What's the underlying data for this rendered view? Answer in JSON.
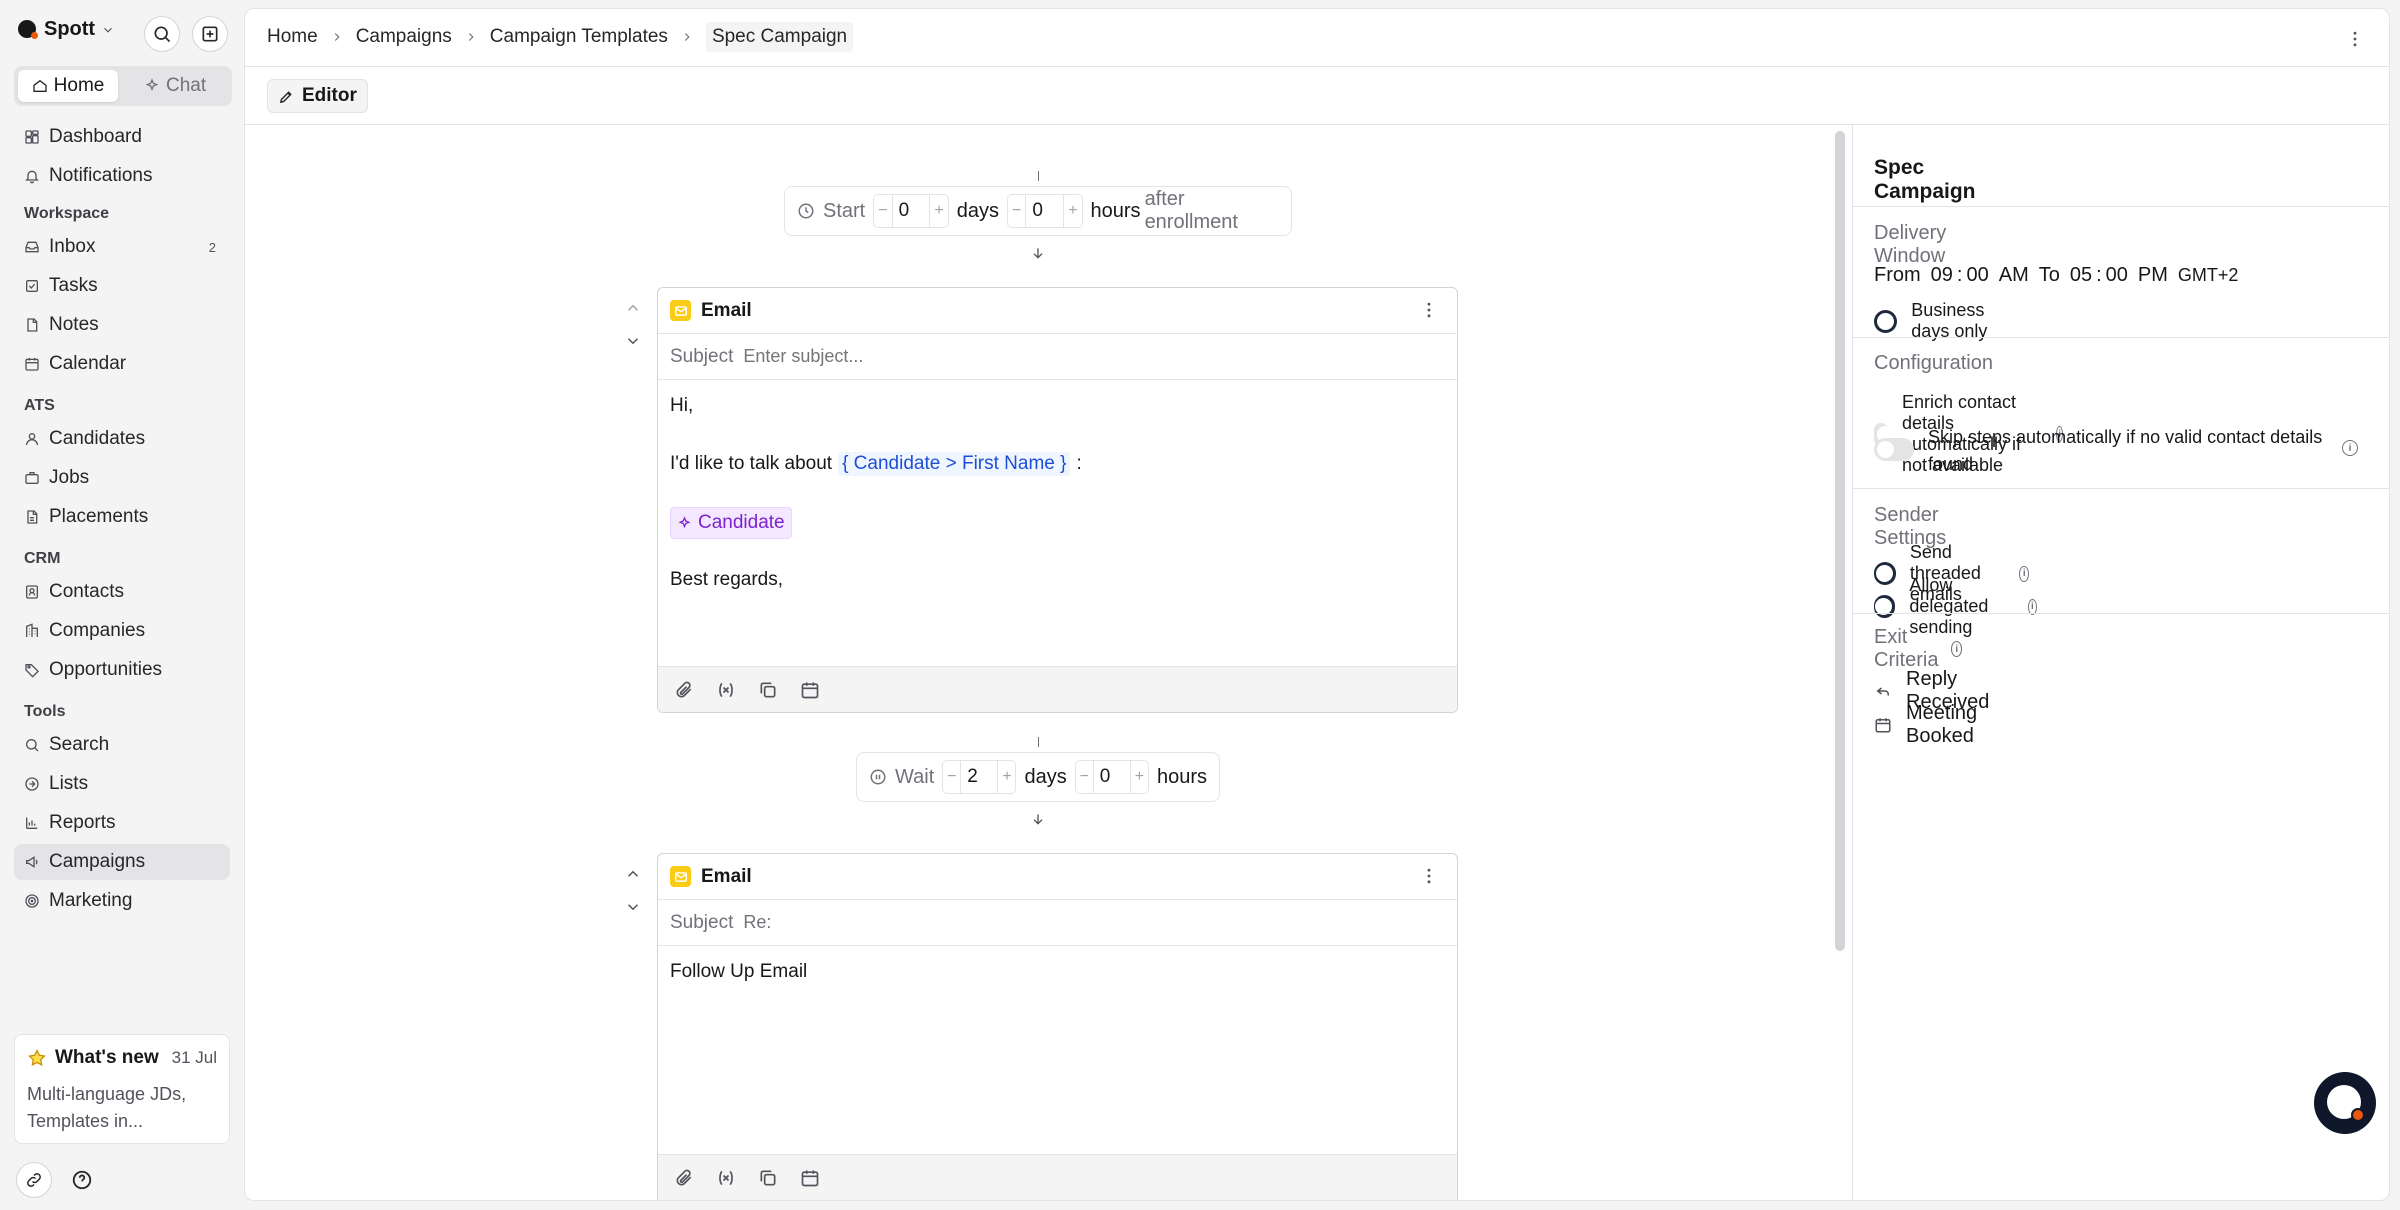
{
  "app": {
    "name": "Spott"
  },
  "sidebar": {
    "home_tab": "Home",
    "chat_tab": "Chat",
    "items_top": [
      {
        "label": "Dashboard",
        "icon": "dashboard-icon"
      },
      {
        "label": "Notifications",
        "icon": "bell-icon"
      }
    ],
    "sections": [
      {
        "label": "Workspace",
        "items": [
          {
            "label": "Inbox",
            "icon": "inbox-icon",
            "badge": "2"
          },
          {
            "label": "Tasks",
            "icon": "tasks-icon"
          },
          {
            "label": "Notes",
            "icon": "notes-icon"
          },
          {
            "label": "Calendar",
            "icon": "calendar-icon"
          }
        ]
      },
      {
        "label": "ATS",
        "items": [
          {
            "label": "Candidates",
            "icon": "user-icon"
          },
          {
            "label": "Jobs",
            "icon": "briefcase-icon"
          },
          {
            "label": "Placements",
            "icon": "document-icon"
          }
        ]
      },
      {
        "label": "CRM",
        "items": [
          {
            "label": "Contacts",
            "icon": "contacts-icon"
          },
          {
            "label": "Companies",
            "icon": "building-icon"
          },
          {
            "label": "Opportunities",
            "icon": "tag-icon"
          }
        ]
      },
      {
        "label": "Tools",
        "items": [
          {
            "label": "Search",
            "icon": "search-icon"
          },
          {
            "label": "Lists",
            "icon": "list-icon"
          },
          {
            "label": "Reports",
            "icon": "chart-icon"
          },
          {
            "label": "Campaigns",
            "icon": "megaphone-icon",
            "active": true
          },
          {
            "label": "Marketing",
            "icon": "target-icon"
          }
        ]
      }
    ],
    "whats_new": {
      "title": "What's new",
      "date": "31 Jul",
      "text": "Multi-language JDs, Templates in..."
    }
  },
  "breadcrumb": [
    "Home",
    "Campaigns",
    "Campaign Templates",
    "Spec Campaign"
  ],
  "toolbar": {
    "editor_label": "Editor"
  },
  "flow": {
    "start": {
      "label": "Start",
      "days": "0",
      "days_label": "days",
      "hours": "0",
      "hours_label": "hours",
      "suffix": "after enrollment"
    },
    "email1": {
      "title": "Email",
      "subject_label": "Subject",
      "subject_placeholder": "Enter subject...",
      "greeting": "Hi,",
      "line_prefix": "I'd like to talk about",
      "variable": "{ Candidate > First Name }",
      "line_suffix": ":",
      "tag": "Candidate",
      "closing": "Best regards,"
    },
    "wait": {
      "label": "Wait",
      "days": "2",
      "days_label": "days",
      "hours": "0",
      "hours_label": "hours"
    },
    "email2": {
      "title": "Email",
      "subject_label": "Subject",
      "subject_value": "Re:",
      "body": "Follow Up Email"
    }
  },
  "right_panel": {
    "title": "Spec Campaign",
    "delivery": {
      "heading": "Delivery Window",
      "from_label": "From",
      "from_h": "09",
      "from_m": "00",
      "from_ampm": "AM",
      "to_label": "To",
      "to_h": "05",
      "to_m": "00",
      "to_ampm": "PM",
      "tz": "GMT+2",
      "business_days": "Business days only",
      "business_days_on": true
    },
    "configuration": {
      "heading": "Configuration",
      "enrich": "Enrich contact details automatically if not available",
      "enrich_on": false,
      "skip": "Skip steps automatically if no valid contact details found",
      "skip_on": false
    },
    "sender": {
      "heading": "Sender Settings",
      "threaded": "Send threaded emails",
      "threaded_on": true,
      "delegated": "Allow delegated sending",
      "delegated_on": true
    },
    "exit": {
      "heading": "Exit Criteria",
      "items": [
        "Reply Received",
        "Meeting Booked"
      ]
    }
  },
  "colors": {
    "accent": "#1e293b",
    "variable_bg": "#eff6ff",
    "variable_text": "#1d4ed8",
    "tag_bg": "#f3e8ff",
    "tag_text": "#7e22ce",
    "email_icon": "#facc15"
  }
}
